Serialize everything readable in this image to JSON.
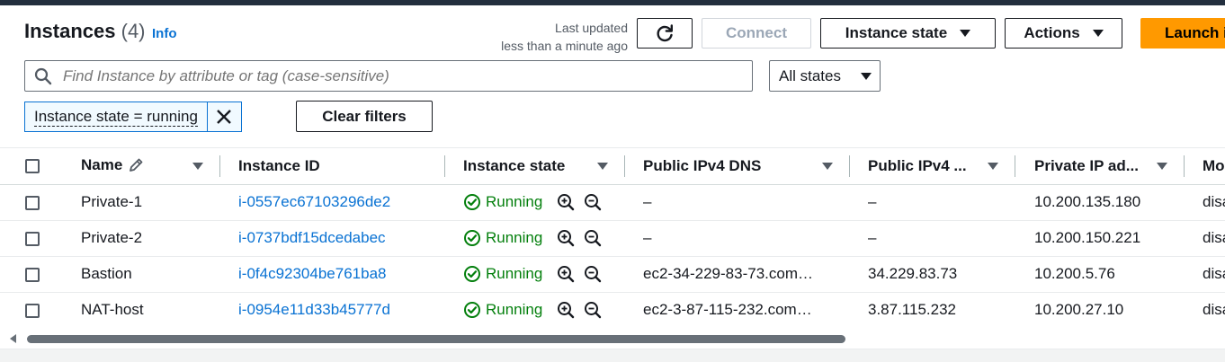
{
  "header": {
    "title": "Instances",
    "count": "(4)",
    "info_label": "Info",
    "last_updated_line1": "Last updated",
    "last_updated_line2": "less than a minute ago"
  },
  "toolbar": {
    "refresh_icon": "refresh-icon",
    "connect_label": "Connect",
    "instance_state_label": "Instance state",
    "actions_label": "Actions",
    "launch_label": "Launch i"
  },
  "search": {
    "placeholder": "Find Instance by attribute or tag (case-sensitive)"
  },
  "state_filter": {
    "selected": "All states"
  },
  "filter_token": {
    "label": "Instance state = running",
    "clear_label": "Clear filters"
  },
  "table": {
    "columns": [
      "Name",
      "Instance ID",
      "Instance state",
      "Public IPv4 DNS",
      "Public IPv4 ...",
      "Private IP ad...",
      "Mo"
    ],
    "rows": [
      {
        "name": "Private-1",
        "id": "i-0557ec67103296de2",
        "state": "Running",
        "dns": "–",
        "ipv4": "–",
        "private_ip": "10.200.135.180",
        "mo": "disa"
      },
      {
        "name": "Private-2",
        "id": "i-0737bdf15dcedabec",
        "state": "Running",
        "dns": "–",
        "ipv4": "–",
        "private_ip": "10.200.150.221",
        "mo": "disa"
      },
      {
        "name": "Bastion",
        "id": "i-0f4c92304be761ba8",
        "state": "Running",
        "dns": "ec2-34-229-83-73.com…",
        "ipv4": "34.229.83.73",
        "private_ip": "10.200.5.76",
        "mo": "disa"
      },
      {
        "name": "NAT-host",
        "id": "i-0954e11d33b45777d",
        "state": "Running",
        "dns": "ec2-3-87-115-232.com…",
        "ipv4": "3.87.115.232",
        "private_ip": "10.200.27.10",
        "mo": "disa"
      }
    ]
  },
  "colors": {
    "link": "#0972d3",
    "running": "#037f0c",
    "primary": "#ff9900"
  }
}
